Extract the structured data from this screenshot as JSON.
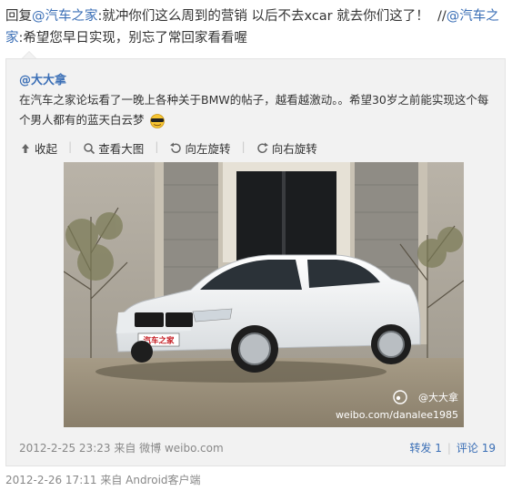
{
  "reply": {
    "prefix": "回复",
    "mention1": "@汽车之家",
    "text1": ":就冲你们这么周到的营销 以后不去xcar 就去你们这了！",
    "forward_sep": "//",
    "mention2": "@汽车之家",
    "text2": ":希望您早日实现，别忘了常回家看看喔"
  },
  "original": {
    "author": "@大大拿",
    "text": "在汽车之家论坛看了一晚上各种关于BMW的帖子，越看越激动。。希望30岁之前能实现这个每个男人都有的蓝天白云梦",
    "emoji": "cool-face-icon",
    "tools": [
      {
        "label": "收起",
        "icon": "collapse-icon"
      },
      {
        "label": "查看大图",
        "icon": "zoom-icon"
      },
      {
        "label": "向左旋转",
        "icon": "rotate-left-icon"
      },
      {
        "label": "向右旋转",
        "icon": "rotate-right-icon"
      }
    ],
    "image": {
      "plate": "汽车之家",
      "watermark_user": "@大大拿",
      "watermark_url": "weibo.com/danalee1985"
    },
    "timestamp": "2012-2-25 23:23 来自 微博 weibo.com",
    "forward_label": "转发 1",
    "comment_label": "评论 19",
    "separator": "|"
  },
  "footer": {
    "timestamp": "2012-2-26 17:11 来自 Android客户端"
  }
}
